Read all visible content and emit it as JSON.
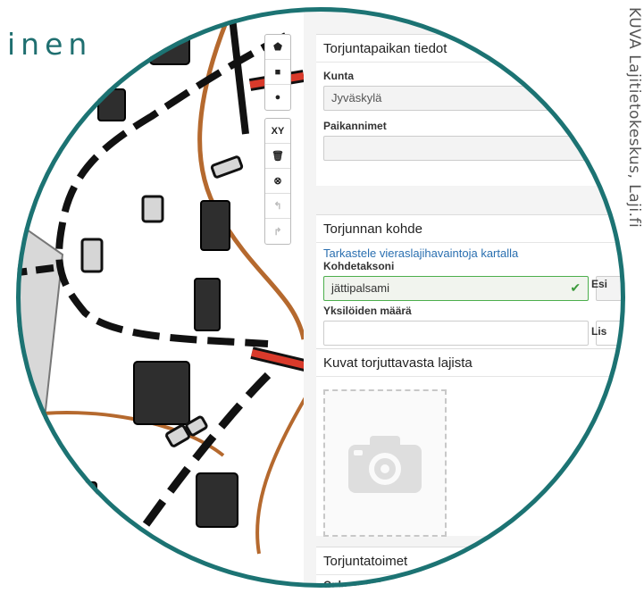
{
  "heading": {
    "text": "inen"
  },
  "credit": {
    "text": "KUVA Lajitietokeskus, Laji.fi"
  },
  "map_toolbar": {
    "draw_tools": [
      {
        "name": "polygon-tool",
        "icon": "pentagon-icon",
        "glyph": "⬟"
      },
      {
        "name": "rectangle-tool",
        "icon": "square-icon",
        "glyph": "■"
      },
      {
        "name": "circle-tool",
        "icon": "circle-icon",
        "glyph": "●"
      }
    ],
    "edit_tools": [
      {
        "name": "coordinates-tool",
        "icon": "xy-icon",
        "glyph": "XY"
      },
      {
        "name": "delete-tool",
        "icon": "trash-icon",
        "glyph": "🗑"
      },
      {
        "name": "clear-tool",
        "icon": "cancel-icon",
        "glyph": "⊗"
      },
      {
        "name": "undo-tool",
        "icon": "undo-icon",
        "glyph": "↰"
      },
      {
        "name": "redo-tool",
        "icon": "redo-icon",
        "glyph": "↱"
      }
    ]
  },
  "form": {
    "location": {
      "title": "Torjuntapaikan tiedot",
      "municipality_label": "Kunta",
      "municipality_value": "Jyväskylä",
      "placenames_label": "Paikannimet",
      "placenames_value": ""
    },
    "target": {
      "title": "Torjunnan kohde",
      "map_link": "Tarkastele vieraslajihavaintoja kartalla",
      "taxon_label": "Kohdetaksoni",
      "taxon_value": "jättipalsami",
      "taxon_check": "✔",
      "occurrence_label_cut": "Esi",
      "count_label": "Yksilöiden määrä",
      "count_value": "",
      "extra_label_cut": "Lis"
    },
    "photos": {
      "title": "Kuvat torjuttavasta lajista",
      "camera_icon": "camera-icon"
    },
    "actions": {
      "title": "Torjuntatoimet",
      "question_label_cut": "Onko esiintym"
    }
  },
  "colors": {
    "accent_teal": "#1c7373",
    "road_brown": "#b5692e",
    "highway_red": "#d93a2b",
    "building_dark": "#2e2e2e",
    "valid_green": "#4cae4c",
    "link_blue": "#2a6fb0"
  }
}
